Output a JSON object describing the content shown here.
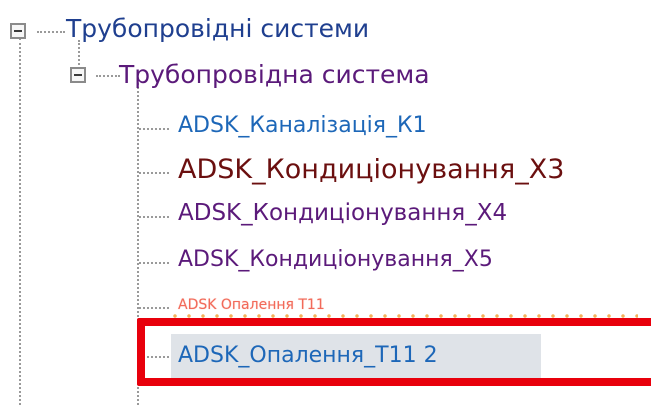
{
  "colors": {
    "root": "#1f3f8f",
    "system": "#5b1a7a",
    "item_blue": "#1d67b8",
    "item_dark_red": "#6b0f0f",
    "item_purple": "#5b1a7a",
    "item_salmon": "#f26a5a",
    "selection": "#dfe3e8",
    "frame_red": "#e8000c"
  },
  "tree": {
    "root": {
      "label": "Трубопровідні системи"
    },
    "system": {
      "label": "Трубопровідна система"
    },
    "items": [
      {
        "label": "ADSK_Каналізація_К1"
      },
      {
        "label": "ADSK_Кондиціонування_Х3"
      },
      {
        "label": "ADSK_Кондиціонування_Х4"
      },
      {
        "label": "ADSK_Кондиціонування_Х5"
      },
      {
        "label": "ADSK Опалення Т11"
      },
      {
        "label": "ADSK_Опалення_Т11 2"
      }
    ]
  }
}
